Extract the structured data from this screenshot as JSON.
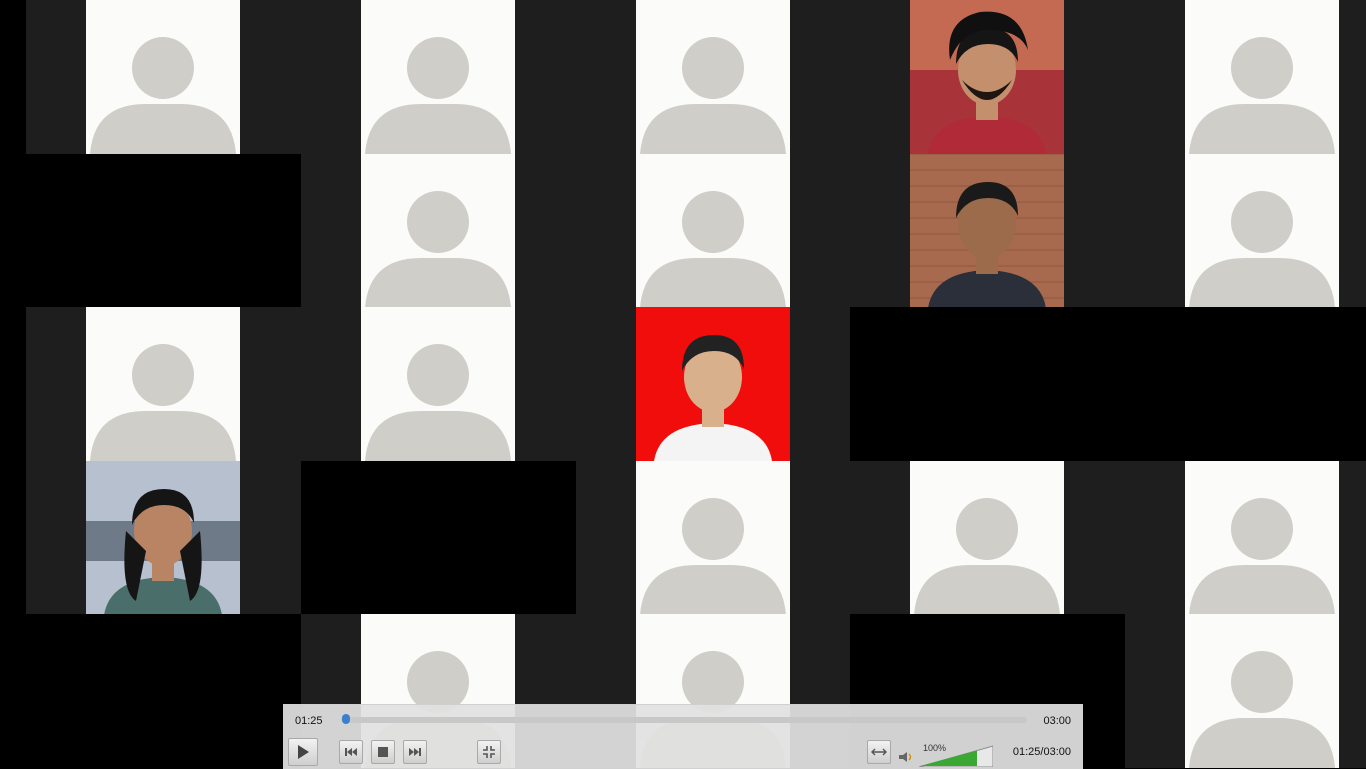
{
  "player": {
    "current_time": "01:25",
    "total_time": "03:00",
    "time_readout": "01:25/03:00",
    "progress": 0.005,
    "volume_label": "100%",
    "volume": 1.0,
    "accent": "#3b7fcf",
    "volume_color": "#3aa832"
  },
  "tiles": [
    {
      "kind": "avatar"
    },
    {
      "kind": "avatar"
    },
    {
      "kind": "avatar"
    },
    {
      "kind": "camera-beard"
    },
    {
      "kind": "avatar"
    },
    {
      "kind": "black"
    },
    {
      "kind": "avatar"
    },
    {
      "kind": "avatar"
    },
    {
      "kind": "camera-brick"
    },
    {
      "kind": "avatar"
    },
    {
      "kind": "avatar"
    },
    {
      "kind": "avatar"
    },
    {
      "kind": "camera-red"
    },
    {
      "kind": "black"
    },
    {
      "kind": "black"
    },
    {
      "kind": "camera-girl"
    },
    {
      "kind": "black"
    },
    {
      "kind": "avatar"
    },
    {
      "kind": "avatar"
    },
    {
      "kind": "avatar"
    },
    {
      "kind": "black"
    },
    {
      "kind": "avatar"
    },
    {
      "kind": "avatar"
    },
    {
      "kind": "black"
    },
    {
      "kind": "avatar"
    }
  ],
  "icons": {
    "play": "play-icon",
    "prev": "skip-back-icon",
    "stop": "stop-icon",
    "next": "skip-forward-icon",
    "fullscreen": "fullscreen-exit-icon",
    "aspect": "aspect-ratio-icon",
    "speaker": "speaker-icon"
  }
}
